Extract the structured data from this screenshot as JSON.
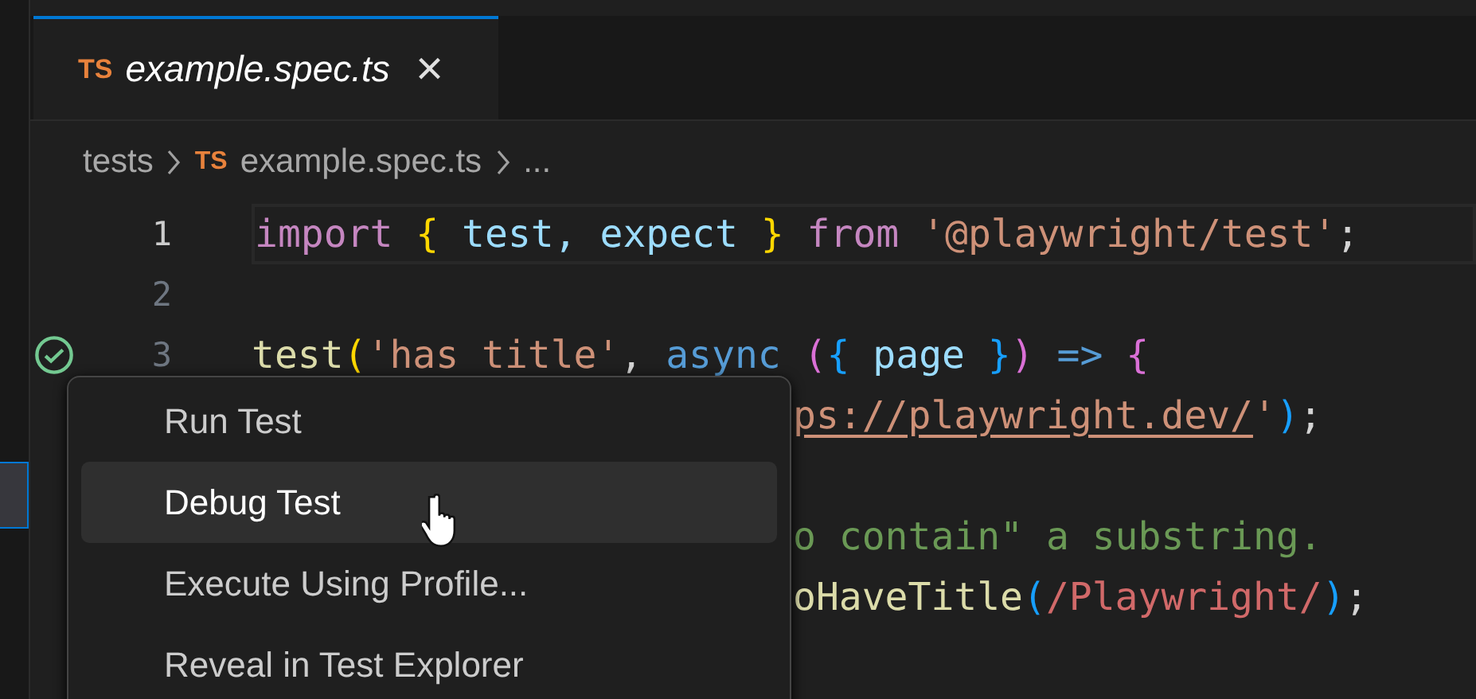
{
  "tab": {
    "icon_text": "TS",
    "title": "example.spec.ts",
    "close": "×",
    "selected": true
  },
  "breadcrumb": [
    {
      "text": "tests"
    },
    {
      "text": "example.spec.ts",
      "icon_text": "TS"
    },
    {
      "text": "..."
    }
  ],
  "code_lines": [
    {
      "number": "1",
      "current": true,
      "tokens": [
        {
          "kind": "keyword",
          "text": "import"
        },
        {
          "kind": "brace",
          "text": " {"
        },
        {
          "kind": "variable",
          "text": " test, expect "
        },
        {
          "kind": "brace",
          "text": "}"
        },
        {
          "kind": "keyword",
          "text": " from"
        },
        {
          "kind": "string",
          "text": " '@playwright/test'"
        },
        {
          "kind": "punct",
          "text": ";"
        }
      ]
    },
    {
      "number": "2"
    },
    {
      "number": "3",
      "passed": true,
      "tokens": [
        {
          "kind": "function",
          "text": "test"
        },
        {
          "kind": "brace",
          "text": "("
        },
        {
          "kind": "string",
          "text": "'has title'"
        },
        {
          "kind": "punct",
          "text": ","
        },
        {
          "kind": "storage",
          "text": " async"
        },
        {
          "kind": "paren2",
          "text": " ("
        },
        {
          "kind": "paren3",
          "text": "{"
        },
        {
          "kind": "variable",
          "text": " page "
        },
        {
          "kind": "paren3",
          "text": "}"
        },
        {
          "kind": "paren2",
          "text": ")"
        },
        {
          "kind": "storage",
          "text": " => "
        },
        {
          "kind": "paren2",
          "text": "{"
        }
      ]
    }
  ],
  "partial_lines": [
    {
      "tokens": [
        {
          "kind": "link",
          "text": "ps://playwright.dev/"
        },
        {
          "kind": "string",
          "text": "'"
        },
        {
          "kind": "paren3",
          "text": ")"
        },
        {
          "kind": "punct",
          "text": ";"
        }
      ]
    },
    {
      "blank": true
    },
    {
      "tokens": [
        {
          "kind": "comment",
          "text": "o contain\" a substring."
        }
      ]
    },
    {
      "tokens": [
        {
          "kind": "function",
          "text": "oHaveTitle"
        },
        {
          "kind": "paren3",
          "text": "("
        },
        {
          "kind": "regex",
          "text": "/Playwright/"
        },
        {
          "kind": "paren3",
          "text": ")"
        },
        {
          "kind": "punct",
          "text": ";"
        }
      ]
    }
  ],
  "context_menu": [
    {
      "label": "Run Test",
      "selected": false
    },
    {
      "label": "Debug Test",
      "selected": true
    },
    {
      "label": "Execute Using Profile...",
      "selected": false
    },
    {
      "label": "Reveal in Test Explorer",
      "selected": false
    }
  ]
}
